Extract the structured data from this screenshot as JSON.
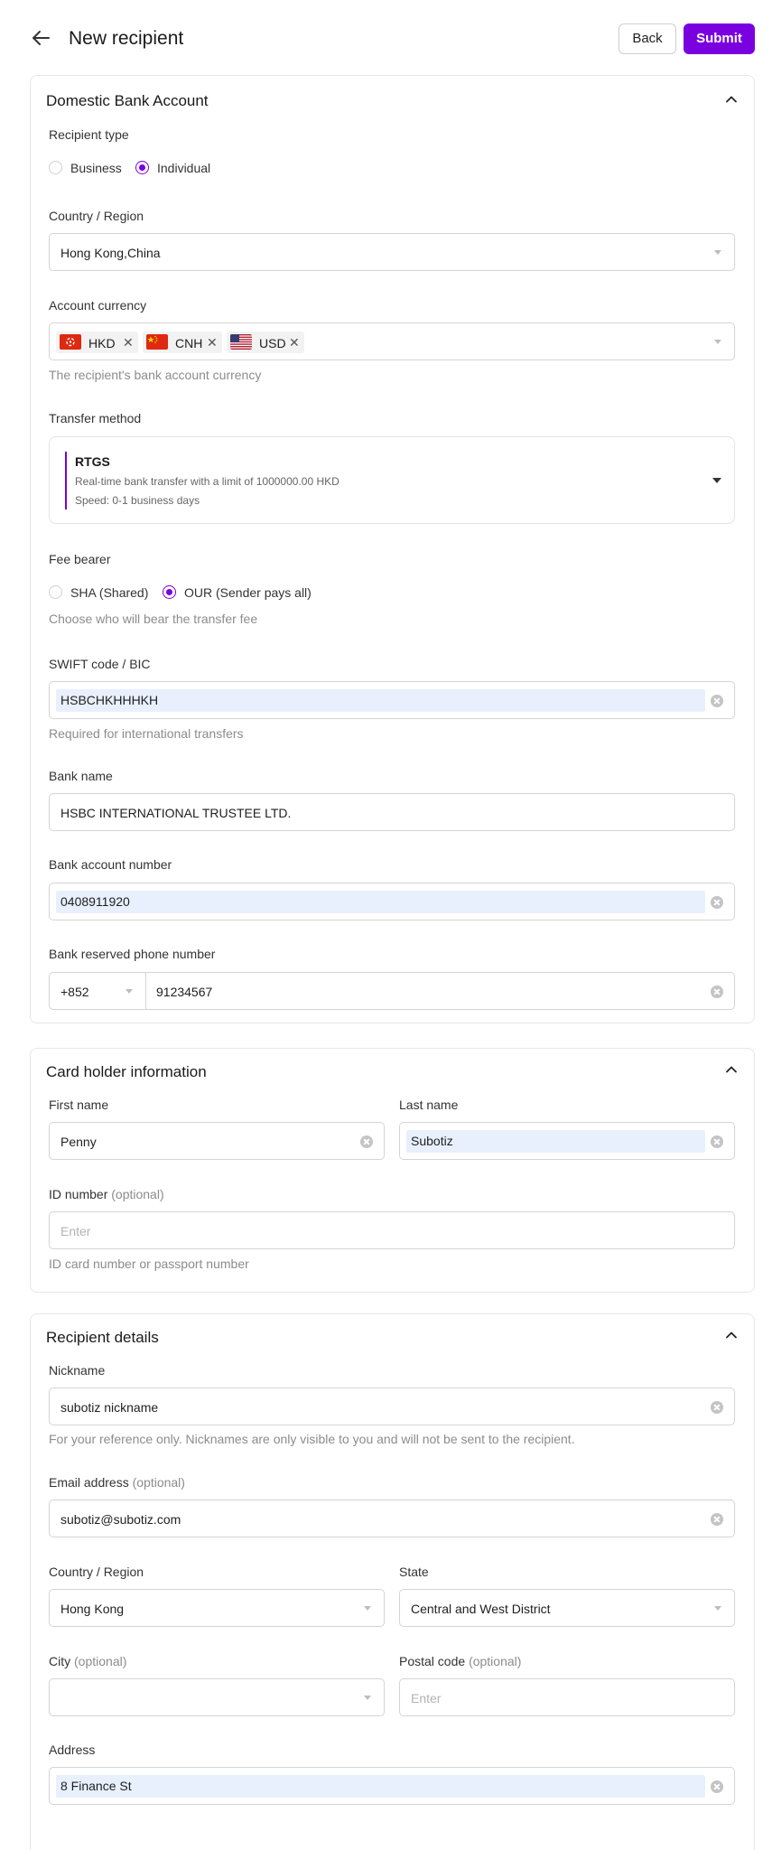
{
  "header": {
    "title": "New recipient",
    "back_label": "Back",
    "submit_label": "Submit"
  },
  "colors": {
    "accent": "#7b00e0",
    "highlight": "#e8f0fe",
    "border": "#d4d4d4"
  },
  "domestic": {
    "title": "Domestic Bank Account",
    "recipient_type": {
      "label": "Recipient type",
      "options": [
        "Business",
        "Individual"
      ],
      "selected": "Individual"
    },
    "country": {
      "label": "Country / Region",
      "value": "Hong Kong,China"
    },
    "currency": {
      "label": "Account currency",
      "tags": [
        {
          "code": "HKD",
          "flag": "hk-flag-icon"
        },
        {
          "code": "CNH",
          "flag": "cn-flag-icon"
        },
        {
          "code": "USD",
          "flag": "us-flag-icon"
        }
      ],
      "help": "The recipient's bank account currency"
    },
    "transfer": {
      "label": "Transfer method",
      "name": "RTGS",
      "desc": "Real-time bank transfer with a limit of 1000000.00 HKD",
      "speed": "Speed: 0-1 business days"
    },
    "fee": {
      "label": "Fee bearer",
      "options": [
        "SHA (Shared)",
        "OUR (Sender pays all)"
      ],
      "selected": "OUR (Sender pays all)",
      "help": "Choose who will bear the transfer fee"
    },
    "swift": {
      "label": "SWIFT code / BIC",
      "value": "HSBCHKHHHKH",
      "help": "Required for international transfers"
    },
    "bank_name": {
      "label": "Bank name",
      "value": "HSBC INTERNATIONAL TRUSTEE LTD."
    },
    "account_number": {
      "label": "Bank account number",
      "value": "0408911920"
    },
    "phone": {
      "label": "Bank reserved phone number",
      "prefix": "+852",
      "value": "91234567"
    }
  },
  "cardholder": {
    "title": "Card holder information",
    "first_name": {
      "label": "First name",
      "value": "Penny"
    },
    "last_name": {
      "label": "Last name",
      "value": "Subotiz"
    },
    "id_number": {
      "label": "ID number",
      "optional": "(optional)",
      "placeholder": "Enter",
      "help": "ID card number or passport number"
    }
  },
  "recipient": {
    "title": "Recipient details",
    "nickname": {
      "label": "Nickname",
      "value": "subotiz nickname",
      "help": "For your reference only. Nicknames are only visible to you and will not be sent to the recipient."
    },
    "email": {
      "label": "Email address",
      "optional": "(optional)",
      "value": "subotiz@subotiz.com"
    },
    "country": {
      "label": "Country / Region",
      "value": "Hong Kong"
    },
    "state": {
      "label": "State",
      "value": "Central and West District"
    },
    "city": {
      "label": "City",
      "optional": "(optional)",
      "value": ""
    },
    "postal": {
      "label": "Postal code",
      "optional": "(optional)",
      "placeholder": "Enter"
    },
    "address": {
      "label": "Address",
      "value": "8 Finance St"
    }
  }
}
